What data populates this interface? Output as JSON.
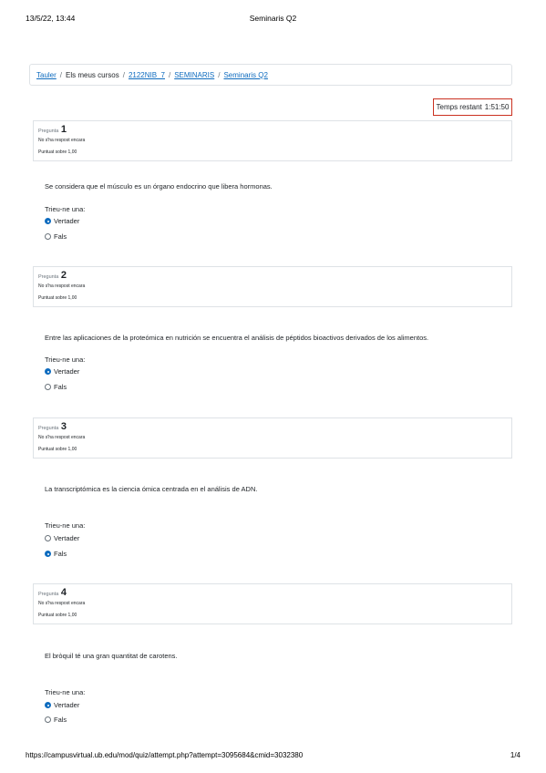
{
  "print_header": {
    "datetime": "13/5/22, 13:44",
    "title": "Seminaris Q2"
  },
  "breadcrumb": {
    "items": [
      {
        "label": "Tauler",
        "link": true
      },
      {
        "label": "Els meus cursos",
        "link": false
      },
      {
        "label": "2122NIB_7",
        "link": true
      },
      {
        "label": "SEMINARIS",
        "link": true
      },
      {
        "label": "Seminaris Q2",
        "link": true
      }
    ],
    "separator": "/"
  },
  "timer": {
    "label": "Temps restant",
    "value": "1:51:50"
  },
  "questions": [
    {
      "prefix": "Pregunta",
      "number": "1",
      "state": "No s'ha respost encara",
      "grade": "Puntuat sobre 1,00",
      "text": "Se considera que el músculo es un órgano endocrino que libera hormonas.",
      "prompt": "Trieu-ne una:",
      "options": [
        {
          "label": "Vertader",
          "checked": true
        },
        {
          "label": "Fals",
          "checked": false
        }
      ]
    },
    {
      "prefix": "Pregunta",
      "number": "2",
      "state": "No s'ha respost encara",
      "grade": "Puntuat sobre 1,00",
      "text": "Entre las aplicaciones de la proteómica en nutrición se encuentra el análisis de péptidos bioactivos derivados de los alimentos.",
      "prompt": "Trieu-ne una:",
      "options": [
        {
          "label": "Vertader",
          "checked": true
        },
        {
          "label": "Fals",
          "checked": false
        }
      ]
    },
    {
      "prefix": "Pregunta",
      "number": "3",
      "state": "No s'ha respost encara",
      "grade": "Puntuat sobre 1,00",
      "text": "La transcriptómica es la ciencia ómica centrada en el análisis de ADN.",
      "prompt": "Trieu-ne una:",
      "options": [
        {
          "label": "Vertader",
          "checked": false
        },
        {
          "label": "Fals",
          "checked": true
        }
      ]
    },
    {
      "prefix": "Pregunta",
      "number": "4",
      "state": "No s'ha respost encara",
      "grade": "Puntuat sobre 1,00",
      "text": "El bròquil té una gran quantitat de carotens.",
      "prompt": "Trieu-ne una:",
      "options": [
        {
          "label": "Vertader",
          "checked": true
        },
        {
          "label": "Fals",
          "checked": false
        }
      ]
    }
  ],
  "print_footer": {
    "url": "https://campusvirtual.ub.edu/mod/quiz/attempt.php?attempt=3095684&cmid=3032380",
    "page": "1/4"
  },
  "colors": {
    "link": "#0f6cbf",
    "timer_border": "#ca3120",
    "border": "#dee2e6"
  }
}
